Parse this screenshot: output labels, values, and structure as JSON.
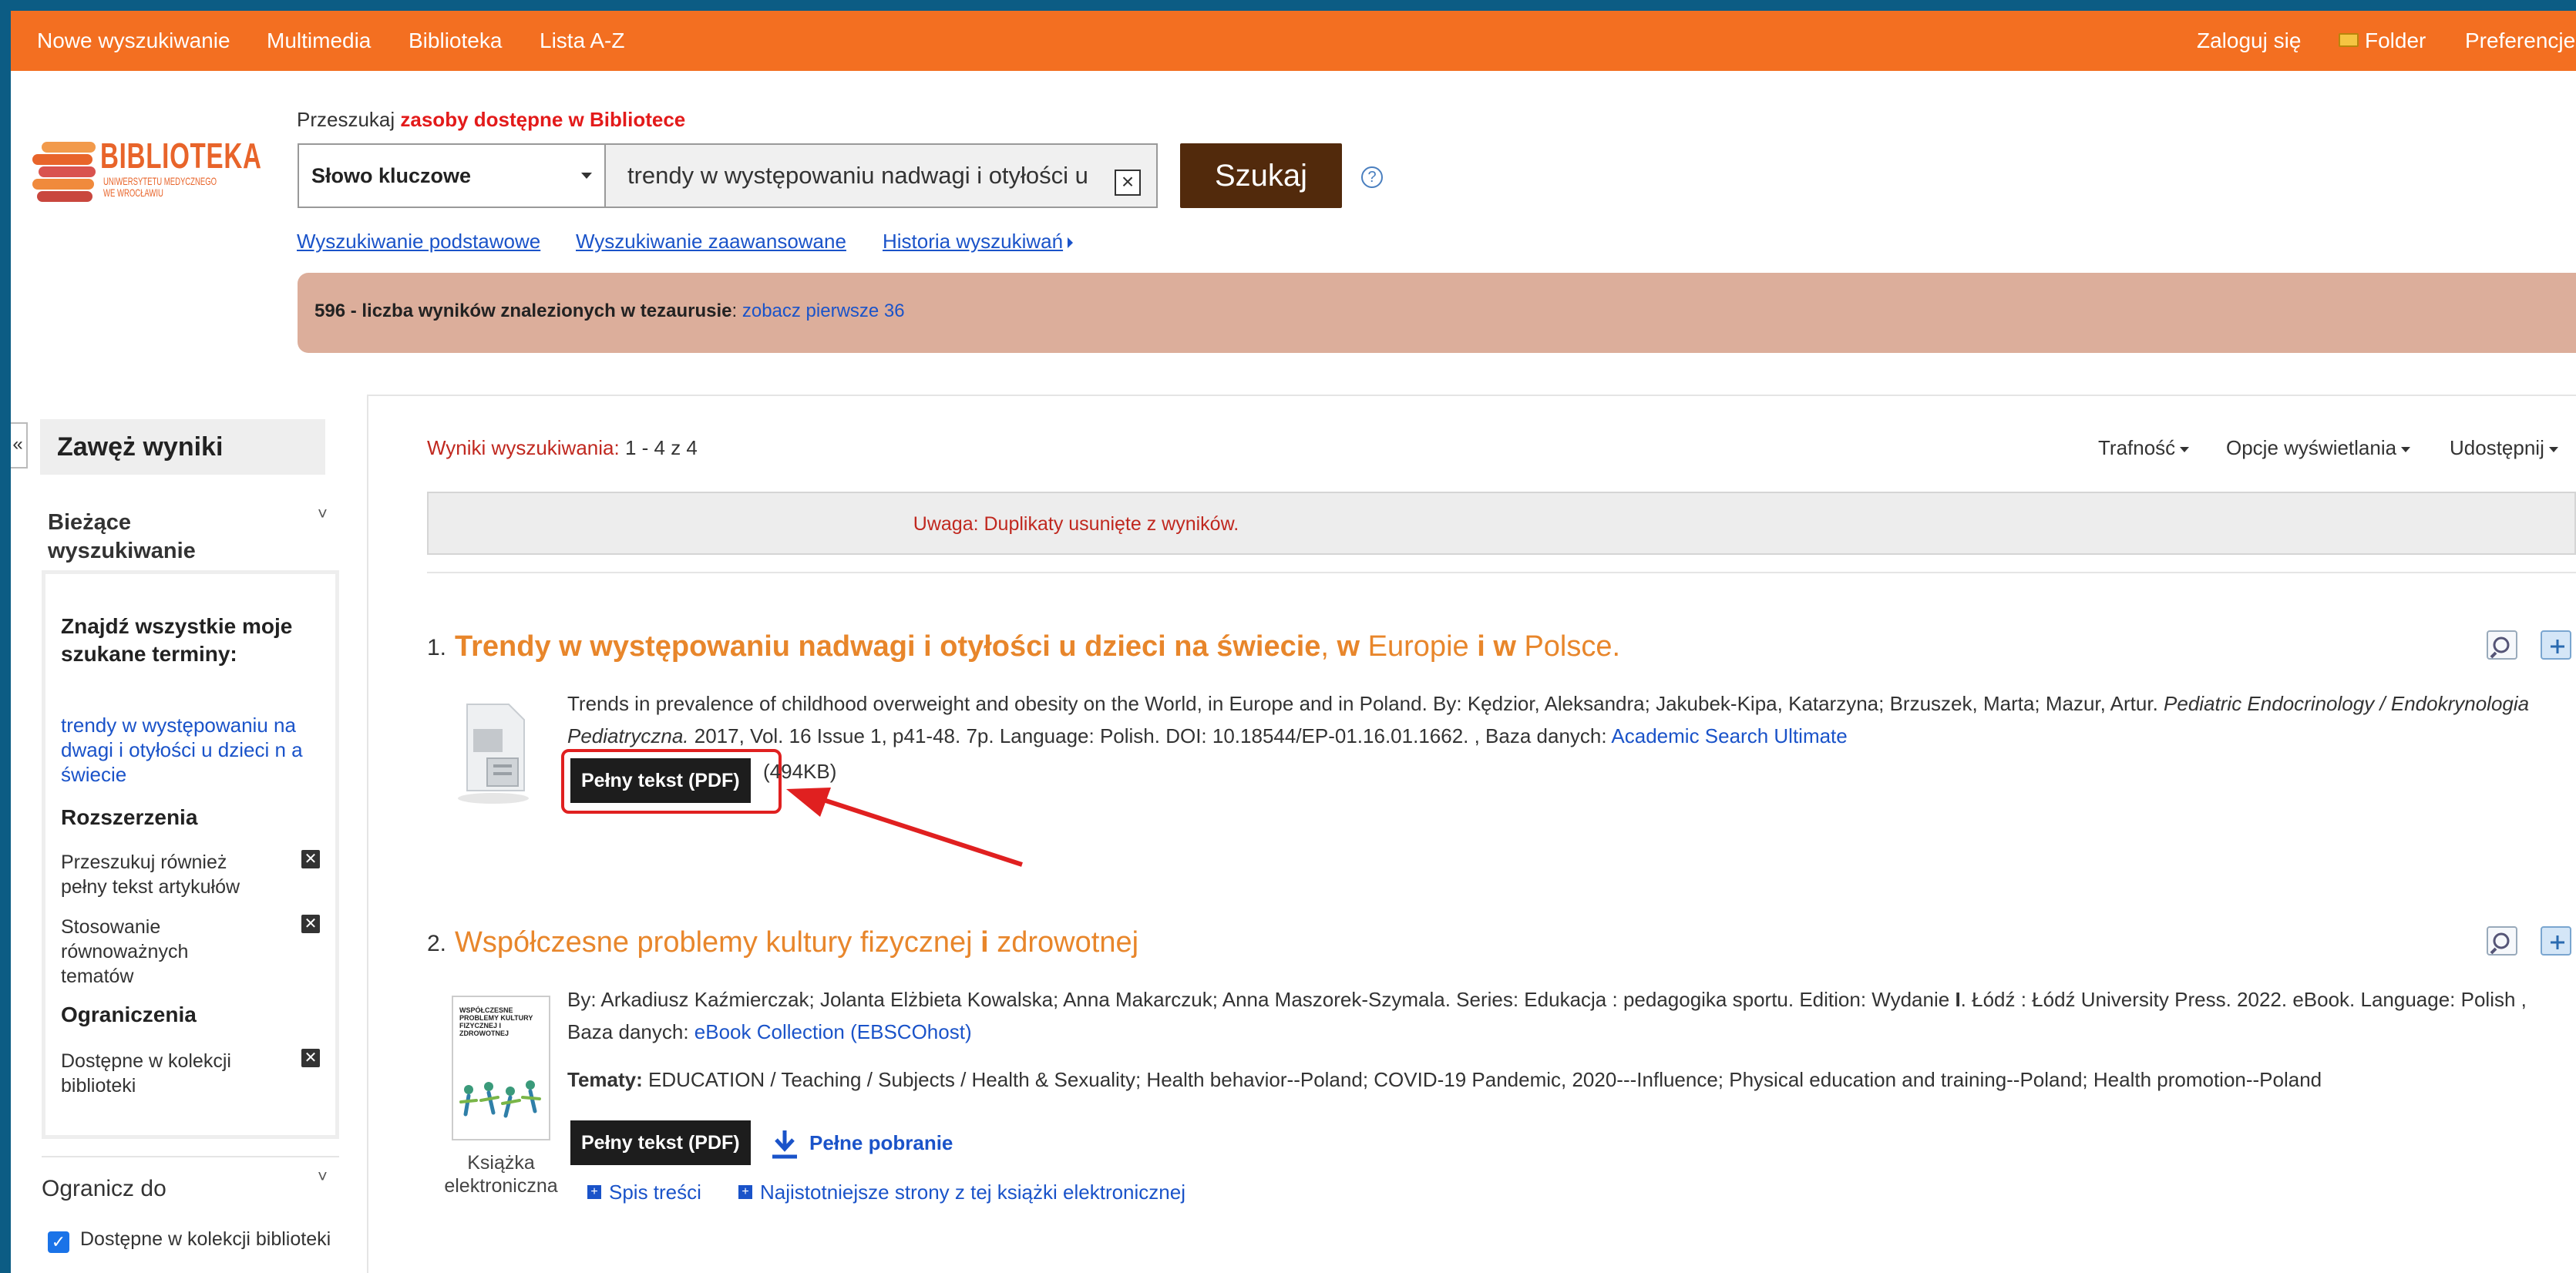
{
  "topnav": {
    "left": [
      "Nowe wyszukiwanie",
      "Multimedia",
      "Biblioteka",
      "Lista A-Z"
    ],
    "login": "Zaloguj się",
    "folder": "Folder",
    "prefs": "Preferencje"
  },
  "logo": {
    "name": "BIBLIOTEKA",
    "line1": "UNIWERSYTETU MEDYCZNEGO",
    "line2": "WE WROCŁAWIU"
  },
  "search": {
    "label_prefix": "Przeszukaj",
    "label_emph": "zasoby dostępne w Bibliotece",
    "field_select": "Słowo kluczowe",
    "query": "trendy w występowaniu nadwagi i otyłości u",
    "clear": "×",
    "submit": "Szukaj",
    "help": "?",
    "links": [
      "Wyszukiwanie podstawowe",
      "Wyszukiwanie zaawansowane",
      "Historia wyszukiwań"
    ]
  },
  "thesaurus": {
    "text": "596 - liczba wyników znalezionych w tezaurusie",
    "sep": ": ",
    "link": "zobacz pierwsze 36"
  },
  "sidebar": {
    "collapse": "«",
    "title": "Zawęż wyniki",
    "current_title": "Bieżące wyszukiwanie",
    "find_all_title": "Znajdź wszystkie moje szukane terminy:",
    "find_all_link": "trendy w występowaniu na dwagi i otyłości u dzieci n a świecie",
    "expanders_title": "Rozszerzenia",
    "expanders": [
      "Przeszukuj również pełny tekst artykułów",
      "Stosowanie równoważnych tematów"
    ],
    "limiters_title": "Ograniczenia",
    "limiters": [
      "Dostępne w kolekcji biblioteki"
    ],
    "limit_to_title": "Ogranicz do",
    "limit_to_option": "Dostępne w kolekcji biblioteki",
    "remove_glyph": "✕",
    "chevron": "˅",
    "check": "✓"
  },
  "results": {
    "header_label": "Wyniki wyszukiwania:",
    "header_range": "1 - 4 z 4",
    "sort": "Trafność",
    "display_options": "Opcje wyświetlania",
    "share": "Udostępnij",
    "notice": "Uwaga: Duplikaty usunięte z wyników.",
    "items": [
      {
        "num": "1.",
        "title_parts": [
          "Trendy w występowaniu nadwagi i otyłości u dzieci na świecie",
          ", ",
          "w",
          " Europie ",
          "i",
          " ",
          "w",
          " Polsce."
        ],
        "desc_a": "Trends in prevalence of childhood overweight and obesity on the World, in Europe and in Poland. By: Kędzior, Aleksandra; Jakubek-Kipa, Katarzyna; Brzuszek, Marta; Mazur, Artur.",
        "desc_journal": "Pediatric Endocrinology / Endokrynologia Pediatryczna.",
        "desc_b": " 2017, Vol. 16 Issue 1, p41-48. 7p. Language: Polish. DOI: 10.18544/EP-01.16.01.1662. , Baza danych: ",
        "database": "Academic Search Ultimate",
        "pdf_button": "Pełny tekst (PDF)",
        "pdf_size": "(494KB)"
      },
      {
        "num": "2.",
        "title_a": "Współczesne problemy kultury fizycznej ",
        "title_bold": "i",
        "title_b": " zdrowotnej",
        "desc_a": "By: Arkadiusz Kaźmierczak; Jolanta Elżbieta Kowalska; Anna Makarczuk; Anna Maszorek-Szymala. Series: Edukacja : pedagogika sportu. Edition: Wydanie ",
        "desc_bold": "I",
        "desc_b": ". Łódź : Łódź University Press. 2022. eBook. Language: Polish , Baza danych: ",
        "database": "eBook Collection (EBSCOhost)",
        "subjects_label": "Tematy:",
        "subjects": " EDUCATION / Teaching / Subjects / Health & Sexuality; Health behavior--Poland; COVID-19 Pandemic, 2020---Influence; Physical education and training--Poland; Health promotion--Poland",
        "type_label": "Książka elektroniczna",
        "pdf_button": "Pełny tekst (PDF)",
        "download": "Pełne pobranie",
        "toc": "Spis treści",
        "relevant": "Najistotniejsze strony z tej książki elektronicznej",
        "cover_title": "WSPÓŁCZESNE PROBLEMY KULTURY FIZYCZNEJ I ZDROWOTNEJ"
      }
    ]
  },
  "colors": {
    "topbar": "#f36f21",
    "submit": "#522a0c",
    "title": "#e8862b",
    "link": "#1a53c9",
    "notice": "#c0281f",
    "annotation": "#e02020"
  }
}
